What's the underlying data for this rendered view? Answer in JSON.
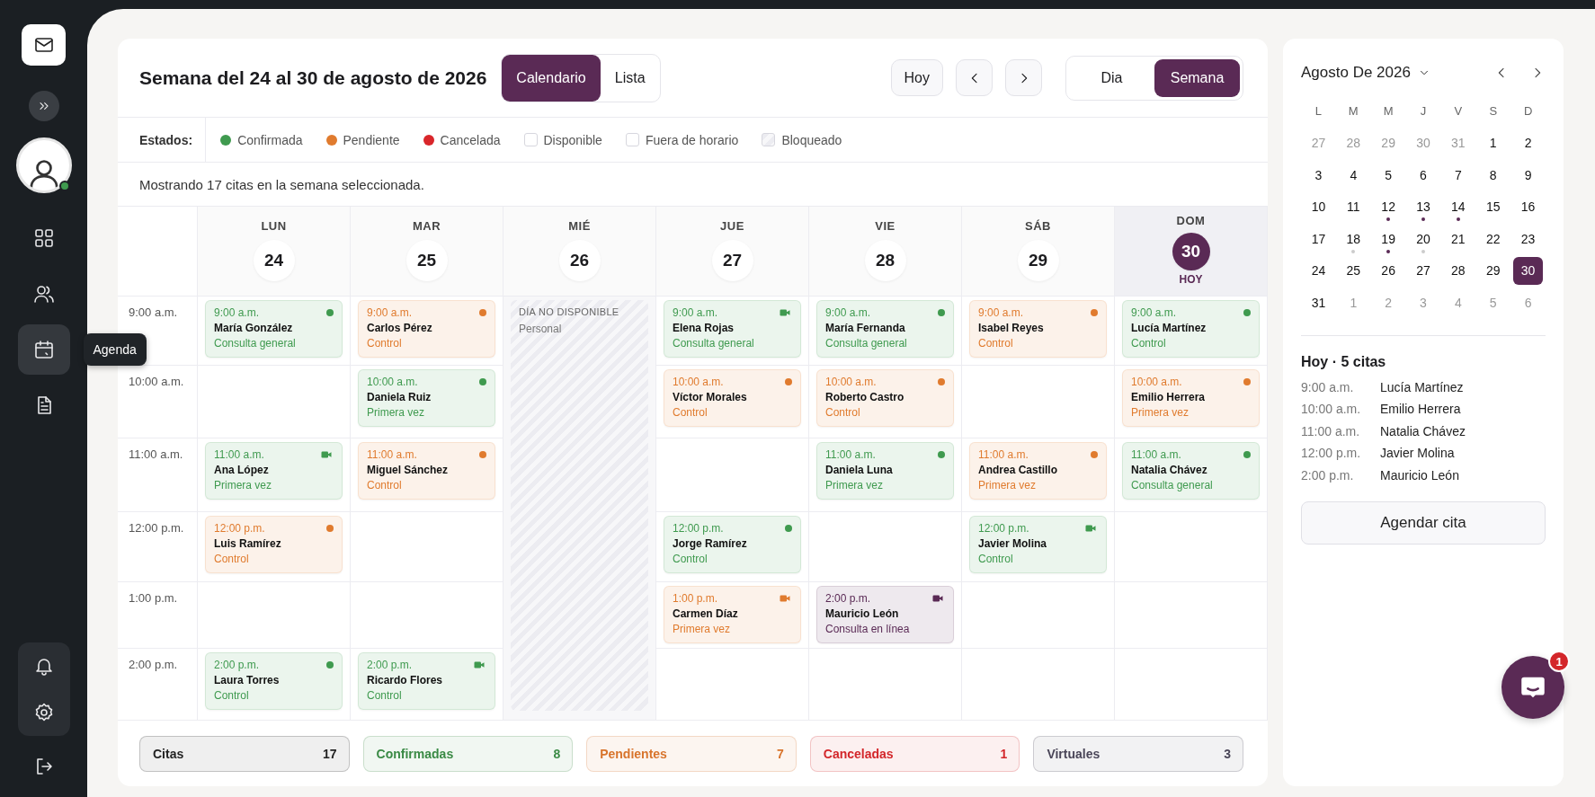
{
  "sidebar": {
    "nav": [
      {
        "kind": "grid",
        "selected": false
      },
      {
        "kind": "users",
        "selected": false
      },
      {
        "kind": "calendar",
        "selected": true
      },
      {
        "kind": "document",
        "selected": false
      }
    ],
    "tooltip": "Agenda",
    "avatar": {
      "online": true
    }
  },
  "header": {
    "title": "Semana del 24 al 30 de agosto de 2026",
    "views": [
      {
        "label": "Calendario",
        "selected": true
      },
      {
        "label": "Lista",
        "selected": false
      }
    ],
    "today_button": "Hoy",
    "ranges": [
      {
        "label": "Dia",
        "selected": false
      },
      {
        "label": "Semana",
        "selected": true
      }
    ]
  },
  "legend": {
    "label": "Estados:",
    "items": [
      {
        "kind": "dot",
        "label": "Confirmada",
        "color": "#3f9a4f"
      },
      {
        "kind": "dot",
        "label": "Pendiente",
        "color": "#e07b2e"
      },
      {
        "kind": "dot",
        "label": "Cancelada",
        "color": "#d9262a"
      },
      {
        "kind": "box",
        "label": "Disponible"
      },
      {
        "kind": "box",
        "label": "Fuera de horario"
      },
      {
        "kind": "hatched",
        "label": "Bloqueado"
      }
    ]
  },
  "info": "Mostrando 17 citas en la semana seleccionada.",
  "times": [
    "9:00 a.m.",
    "10:00 a.m.",
    "11:00 a.m.",
    "12:00 p.m.",
    "1:00 p.m.",
    "2:00 p.m."
  ],
  "days": [
    {
      "dow": "LUN",
      "date": "24",
      "today": false,
      "slots": [
        {
          "kind": "appointment",
          "time": "9:00 a.m.",
          "name": "María González",
          "type": "Consulta general",
          "color": "#3f9a4f"
        },
        {
          "kind": "empty"
        },
        {
          "kind": "video",
          "time": "11:00 a.m.",
          "name": "Ana López",
          "type": "Primera vez",
          "color": "#3f9a4f"
        },
        {
          "kind": "appointment",
          "time": "12:00 p.m.",
          "name": "Luis Ramírez",
          "type": "Control",
          "color": "#e07b2e"
        },
        {
          "kind": "empty"
        },
        {
          "kind": "appointment",
          "time": "2:00 p.m.",
          "name": "Laura Torres",
          "type": "Control",
          "color": "#3f9a4f"
        }
      ]
    },
    {
      "dow": "MAR",
      "date": "25",
      "today": false,
      "slots": [
        {
          "kind": "appointment",
          "time": "9:00 a.m.",
          "name": "Carlos Pérez",
          "type": "Control",
          "color": "#e07b2e"
        },
        {
          "kind": "appointment",
          "time": "10:00 a.m.",
          "name": "Daniela Ruiz",
          "type": "Primera vez",
          "color": "#3f9a4f"
        },
        {
          "kind": "appointment",
          "time": "11:00 a.m.",
          "name": "Miguel Sánchez",
          "type": "Control",
          "color": "#e07b2e"
        },
        {
          "kind": "empty"
        },
        {
          "kind": "empty"
        },
        {
          "kind": "video",
          "time": "2:00 p.m.",
          "name": "Ricardo Flores",
          "type": "Control",
          "color": "#3f9a4f"
        }
      ]
    },
    {
      "dow": "MIÉ",
      "date": "26",
      "today": false,
      "blocked": {
        "label": "DÍA NO DISPONIBLE",
        "reason": "Personal"
      }
    },
    {
      "dow": "JUE",
      "date": "27",
      "today": false,
      "slots": [
        {
          "kind": "video",
          "time": "9:00 a.m.",
          "name": "Elena Rojas",
          "type": "Consulta general",
          "color": "#3f9a4f"
        },
        {
          "kind": "appointment",
          "time": "10:00 a.m.",
          "name": "Víctor Morales",
          "type": "Control",
          "color": "#e07b2e"
        },
        {
          "kind": "empty"
        },
        {
          "kind": "appointment",
          "time": "12:00 p.m.",
          "name": "Jorge Ramírez",
          "type": "Control",
          "color": "#3f9a4f"
        },
        {
          "kind": "video",
          "time": "1:00 p.m.",
          "name": "Carmen Díaz",
          "type": "Primera vez",
          "color": "#e07b2e"
        },
        {
          "kind": "empty"
        }
      ]
    },
    {
      "dow": "VIE",
      "date": "28",
      "today": false,
      "slots": [
        {
          "kind": "appointment",
          "time": "9:00 a.m.",
          "name": "María Fernanda",
          "type": "Consulta general",
          "color": "#3f9a4f"
        },
        {
          "kind": "appointment",
          "time": "10:00 a.m.",
          "name": "Roberto Castro",
          "type": "Control",
          "color": "#e07b2e"
        },
        {
          "kind": "appointment",
          "time": "11:00 a.m.",
          "name": "Daniela Luna",
          "type": "Primera vez",
          "color": "#3f9a4f"
        },
        {
          "kind": "empty"
        },
        {
          "kind": "video",
          "time": "2:00 p.m.",
          "name": "Mauricio León",
          "type": "Consulta en línea",
          "color": "#5a2a55"
        },
        {
          "kind": "empty"
        }
      ]
    },
    {
      "dow": "SÁB",
      "date": "29",
      "today": false,
      "slots": [
        {
          "kind": "appointment",
          "time": "9:00 a.m.",
          "name": "Isabel Reyes",
          "type": "Control",
          "color": "#e07b2e"
        },
        {
          "kind": "empty"
        },
        {
          "kind": "appointment",
          "time": "11:00 a.m.",
          "name": "Andrea Castillo",
          "type": "Primera vez",
          "color": "#e07b2e"
        },
        {
          "kind": "video",
          "time": "12:00 p.m.",
          "name": "Javier Molina",
          "type": "Control",
          "color": "#3f9a4f"
        },
        {
          "kind": "empty"
        },
        {
          "kind": "empty"
        }
      ]
    },
    {
      "dow": "DOM",
      "date": "30",
      "today": true,
      "today_label": "HOY",
      "slots": [
        {
          "kind": "appointment",
          "time": "9:00 a.m.",
          "name": "Lucía Martínez",
          "type": "Control",
          "color": "#3f9a4f"
        },
        {
          "kind": "appointment",
          "time": "10:00 a.m.",
          "name": "Emilio Herrera",
          "type": "Primera vez",
          "color": "#e07b2e"
        },
        {
          "kind": "appointment",
          "time": "11:00 a.m.",
          "name": "Natalia Chávez",
          "type": "Consulta general",
          "color": "#3f9a4f"
        },
        {
          "kind": "empty"
        },
        {
          "kind": "empty"
        },
        {
          "kind": "empty"
        }
      ]
    }
  ],
  "summary": [
    {
      "label": "Citas",
      "count": "17",
      "color": "#222222"
    },
    {
      "label": "Confirmadas",
      "count": "8",
      "color": "#3a8a45"
    },
    {
      "label": "Pendientes",
      "count": "7",
      "color": "#d8742c"
    },
    {
      "label": "Canceladas",
      "count": "1",
      "color": "#d3262a"
    },
    {
      "label": "Virtuales",
      "count": "3",
      "color": "#4a4658"
    }
  ],
  "mini_calendar": {
    "title": "Agosto De 2026",
    "weekdays": [
      "L",
      "M",
      "M",
      "J",
      "V",
      "S",
      "D"
    ],
    "weeks": [
      [
        {
          "day": "27",
          "outside": true,
          "selected": false
        },
        {
          "day": "28",
          "outside": true,
          "selected": false
        },
        {
          "day": "29",
          "outside": true,
          "selected": false
        },
        {
          "day": "30",
          "outside": true,
          "selected": false
        },
        {
          "day": "31",
          "outside": true,
          "selected": false
        },
        {
          "day": "1",
          "outside": false,
          "selected": false
        },
        {
          "day": "2",
          "outside": false,
          "selected": false
        }
      ],
      [
        {
          "day": "3",
          "outside": false,
          "selected": false
        },
        {
          "day": "4",
          "outside": false,
          "selected": false
        },
        {
          "day": "5",
          "outside": false,
          "selected": false
        },
        {
          "day": "6",
          "outside": false,
          "selected": false
        },
        {
          "day": "7",
          "outside": false,
          "selected": false
        },
        {
          "day": "8",
          "outside": false,
          "selected": false
        },
        {
          "day": "9",
          "outside": false,
          "selected": false
        }
      ],
      [
        {
          "day": "10",
          "outside": false,
          "selected": false
        },
        {
          "day": "11",
          "outside": false,
          "selected": false
        },
        {
          "day": "12",
          "outside": false,
          "selected": false,
          "color": "#5a2a55"
        },
        {
          "day": "13",
          "outside": false,
          "selected": false,
          "color": "#5a2a55"
        },
        {
          "day": "14",
          "outside": false,
          "selected": false,
          "color": "#5a2a55"
        },
        {
          "day": "15",
          "outside": false,
          "selected": false
        },
        {
          "day": "16",
          "outside": false,
          "selected": false
        }
      ],
      [
        {
          "day": "17",
          "outside": false,
          "selected": false
        },
        {
          "day": "18",
          "outside": false,
          "selected": false,
          "color": "#cccccc"
        },
        {
          "day": "19",
          "outside": false,
          "selected": false,
          "color": "#5a2a55"
        },
        {
          "day": "20",
          "outside": false,
          "selected": false,
          "color": "#cccccc"
        },
        {
          "day": "21",
          "outside": false,
          "selected": false
        },
        {
          "day": "22",
          "outside": false,
          "selected": false
        },
        {
          "day": "23",
          "outside": false,
          "selected": false
        }
      ],
      [
        {
          "day": "24",
          "outside": false,
          "selected": false
        },
        {
          "day": "25",
          "outside": false,
          "selected": false
        },
        {
          "day": "26",
          "outside": false,
          "selected": false
        },
        {
          "day": "27",
          "outside": false,
          "selected": false
        },
        {
          "day": "28",
          "outside": false,
          "selected": false
        },
        {
          "day": "29",
          "outside": false,
          "selected": false
        },
        {
          "day": "30",
          "outside": false,
          "selected": true
        }
      ],
      [
        {
          "day": "31",
          "outside": false,
          "selected": false
        },
        {
          "day": "1",
          "outside": true,
          "selected": false
        },
        {
          "day": "2",
          "outside": true,
          "selected": false
        },
        {
          "day": "3",
          "outside": true,
          "selected": false
        },
        {
          "day": "4",
          "outside": true,
          "selected": false
        },
        {
          "day": "5",
          "outside": true,
          "selected": false
        },
        {
          "day": "6",
          "outside": true,
          "selected": false
        }
      ]
    ]
  },
  "today_list": {
    "title": "Hoy · 5 citas",
    "items": [
      {
        "time": "9:00 a.m.",
        "name": "Lucía Martínez"
      },
      {
        "time": "10:00 a.m.",
        "name": "Emilio Herrera"
      },
      {
        "time": "11:00 a.m.",
        "name": "Natalia Chávez"
      },
      {
        "time": "12:00 p.m.",
        "name": "Javier Molina"
      },
      {
        "time": "2:00 p.m.",
        "name": "Mauricio León"
      }
    ]
  },
  "schedule_button": "Agendar cita",
  "chat": {
    "badge": "1"
  }
}
